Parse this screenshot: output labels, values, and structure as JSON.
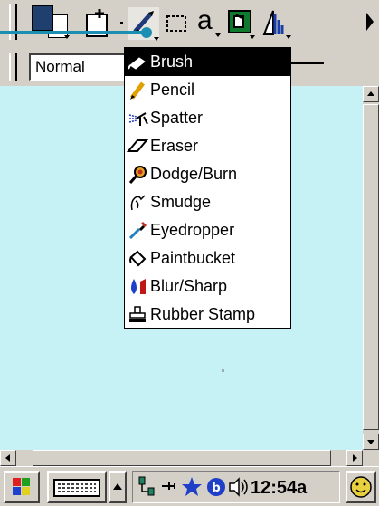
{
  "toolbar": {
    "tools": [
      {
        "name": "color-swatch"
      },
      {
        "name": "new-document"
      },
      {
        "name": "brush-tool",
        "active": true
      },
      {
        "name": "selection-tool"
      },
      {
        "name": "text-tool",
        "label": "a"
      },
      {
        "name": "fill-tool"
      },
      {
        "name": "filter-tool"
      }
    ],
    "foreground_color": "#1f3f6e",
    "background_color": "#ffffff"
  },
  "options_bar": {
    "blend_mode": "Normal"
  },
  "tool_menu": {
    "items": [
      {
        "label": "Brush",
        "icon": "brush-icon",
        "selected": true
      },
      {
        "label": "Pencil",
        "icon": "pencil-icon"
      },
      {
        "label": "Spatter",
        "icon": "spatter-icon"
      },
      {
        "label": "Eraser",
        "icon": "eraser-icon"
      },
      {
        "label": "Dodge/Burn",
        "icon": "dodge-burn-icon"
      },
      {
        "label": "Smudge",
        "icon": "smudge-icon"
      },
      {
        "label": "Eyedropper",
        "icon": "eyedropper-icon"
      },
      {
        "label": "Paintbucket",
        "icon": "paintbucket-icon"
      },
      {
        "label": "Blur/Sharp",
        "icon": "blur-sharp-icon"
      },
      {
        "label": "Rubber Stamp",
        "icon": "rubber-stamp-icon"
      }
    ]
  },
  "canvas": {
    "background": "#c6f2f6"
  },
  "taskbar": {
    "clock": "12:54a",
    "tray_icons": [
      "network-icon",
      "power-icon",
      "star-icon",
      "bluetooth-icon",
      "volume-icon"
    ]
  },
  "colors": {
    "accent": "#1a8fb2",
    "chrome": "#d4d0c8",
    "menu_highlight": "#000000"
  }
}
